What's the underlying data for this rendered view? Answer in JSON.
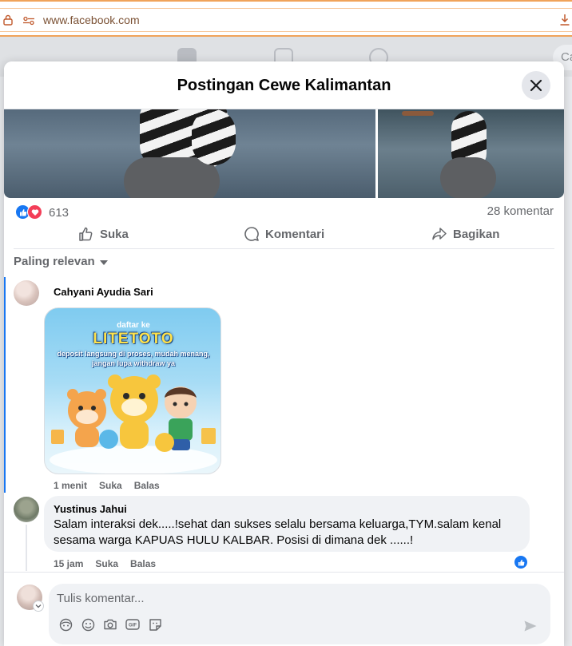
{
  "browser": {
    "url": "www.facebook.com"
  },
  "background": {
    "search_placeholder_partial": "Ca"
  },
  "modal": {
    "title": "Postingan Cewe Kalimantan"
  },
  "post": {
    "reaction_count": "613",
    "comment_count": "28 komentar",
    "actions": {
      "like": "Suka",
      "comment": "Komentari",
      "share": "Bagikan"
    }
  },
  "sort": {
    "label": "Paling relevan"
  },
  "comments": [
    {
      "author": "Cahyani Ayudia Sari",
      "sticker": {
        "sub": "daftar ke",
        "brand": "LITETOTO",
        "line1": "deposit langsung di proses, mudah menang,",
        "line2": "jangan lupa withdraw ya"
      },
      "time": "1 menit",
      "like_label": "Suka",
      "reply_label": "Balas"
    },
    {
      "author": "Yustinus Jahui",
      "text": "Salam interaksi dek.....!sehat dan sukses selalu bersama keluarga,TYM.salam kenal sesama warga KAPUAS HULU KALBAR. Posisi di dimana dek ......!",
      "time": "15 jam",
      "like_label": "Suka",
      "reply_label": "Balas",
      "reactions": [
        "like"
      ]
    }
  ],
  "composer": {
    "placeholder": "Tulis komentar..."
  },
  "colors": {
    "accent": "#1877f2",
    "love": "#f33e58",
    "secondary_text": "#65676b",
    "bubble": "#f0f2f5",
    "browser_accent": "#f0a35a"
  }
}
